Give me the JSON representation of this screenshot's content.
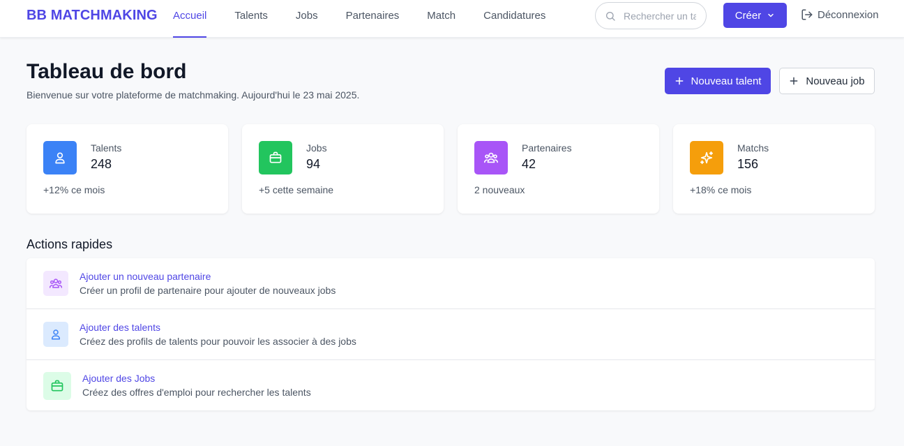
{
  "header": {
    "brand": "BB MATCHMAKING",
    "nav": [
      "Accueil",
      "Talents",
      "Jobs",
      "Partenaires",
      "Match",
      "Candidatures"
    ],
    "active_nav": "Accueil",
    "search_placeholder": "Rechercher un talent",
    "create_label": "Créer",
    "logout_label": "Déconnexion",
    "accent": "#4f46e5"
  },
  "page": {
    "title": "Tableau de bord",
    "subtitle": "Bienvenue sur votre plateforme de matchmaking. Aujourd'hui le 23 mai 2025.",
    "new_talent_label": "Nouveau talent",
    "new_job_label": "Nouveau job"
  },
  "stats": [
    {
      "label": "Talents",
      "value": "248",
      "delta": "+12% ce mois",
      "color": "#3b82f6",
      "icon": "user-icon"
    },
    {
      "label": "Jobs",
      "value": "94",
      "delta": "+5 cette semaine",
      "color": "#22c55e",
      "icon": "briefcase-icon"
    },
    {
      "label": "Partenaires",
      "value": "42",
      "delta": "2 nouveaux",
      "color": "#a855f7",
      "icon": "users-icon"
    },
    {
      "label": "Matchs",
      "value": "156",
      "delta": "+18% ce mois",
      "color": "#f59e0b",
      "icon": "sparkles-icon"
    }
  ],
  "quick_actions": {
    "title": "Actions rapides",
    "items": [
      {
        "title": "Ajouter un nouveau partenaire",
        "description": "Créer un profil de partenaire pour ajouter de nouveaux jobs",
        "icon": "users-icon",
        "bg": "#f3e8ff",
        "fg": "#a855f7"
      },
      {
        "title": "Ajouter des talents",
        "description": "Créez des profils de talents pour pouvoir les associer à des jobs",
        "icon": "user-icon",
        "bg": "#dbeafe",
        "fg": "#3b82f6"
      },
      {
        "title": "Ajouter des Jobs",
        "description": "Créez des offres d'emploi pour rechercher les talents",
        "icon": "briefcase-icon",
        "bg": "#dcfce7",
        "fg": "#22c55e"
      }
    ]
  }
}
